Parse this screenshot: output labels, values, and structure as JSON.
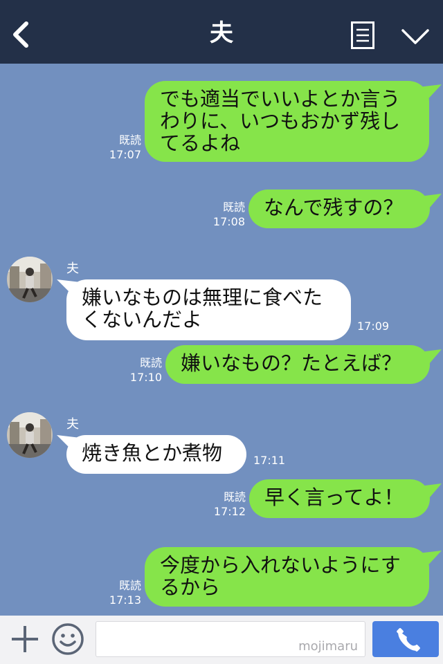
{
  "header": {
    "title": "夫"
  },
  "messages": [
    {
      "lines": [
        "でも適当でいいよとか言う",
        "わりに、いつもおかず残し",
        "てるよね"
      ],
      "read": "既読",
      "time": "17:07"
    },
    {
      "lines": [
        "なんで残すの？"
      ],
      "read": "既読",
      "time": "17:08"
    },
    {
      "sender": "夫",
      "lines": [
        "嫌いなものは無理に食べた",
        "くないんだよ"
      ],
      "time": "17:09"
    },
    {
      "lines": [
        "嫌いなもの？たとえば？"
      ],
      "read": "既読",
      "time": "17:10"
    },
    {
      "sender": "夫",
      "lines": [
        "焼き魚とか煮物"
      ],
      "time": "17:11"
    },
    {
      "lines": [
        "早く言ってよ！"
      ],
      "read": "既読",
      "time": "17:12"
    },
    {
      "lines": [
        "今度から入れないようにす",
        "るから"
      ],
      "read": "既読",
      "time": "17:13"
    }
  ],
  "footer": {
    "watermark": "mojimaru"
  },
  "colors": {
    "header": "#233048",
    "background": "#7290bf",
    "my_bubble": "#86e44a",
    "their_bubble": "#ffffff",
    "call_button": "#4a7fe0"
  },
  "icons": [
    "back-arrow-icon",
    "menu-list-icon",
    "chevron-down-icon",
    "plus-icon",
    "emoji-icon",
    "phone-icon"
  ]
}
